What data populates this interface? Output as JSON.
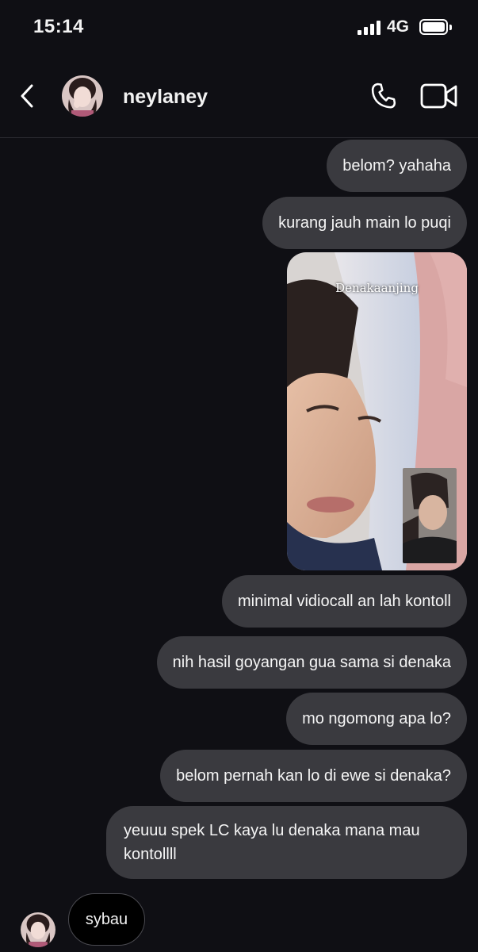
{
  "status_bar": {
    "time": "15:14",
    "network": "4G",
    "battery_level": 1.0
  },
  "header": {
    "contact_name": "neylaney",
    "back_icon": "chevron-left-icon",
    "call_icon": "phone-icon",
    "video_icon": "video-camera-icon"
  },
  "messages": {
    "m1": "belom? yahaha",
    "m2": "kurang jauh main lo puqi",
    "photo_caption": "Denakaanjing",
    "m3": "minimal vidiocall an lah kontoll",
    "m4": "nih hasil goyangan gua sama si denaka",
    "m5": "mo ngomong apa lo?",
    "m6": "belom pernah kan lo di ewe si denaka?",
    "m7": "yeuuu spek LC kaya lu denaka mana mau kontollll",
    "incoming": "sybau"
  },
  "colors": {
    "background": "#0f0f14",
    "outgoing_bubble": "#3a3a3f",
    "incoming_bubble": "#000000"
  }
}
